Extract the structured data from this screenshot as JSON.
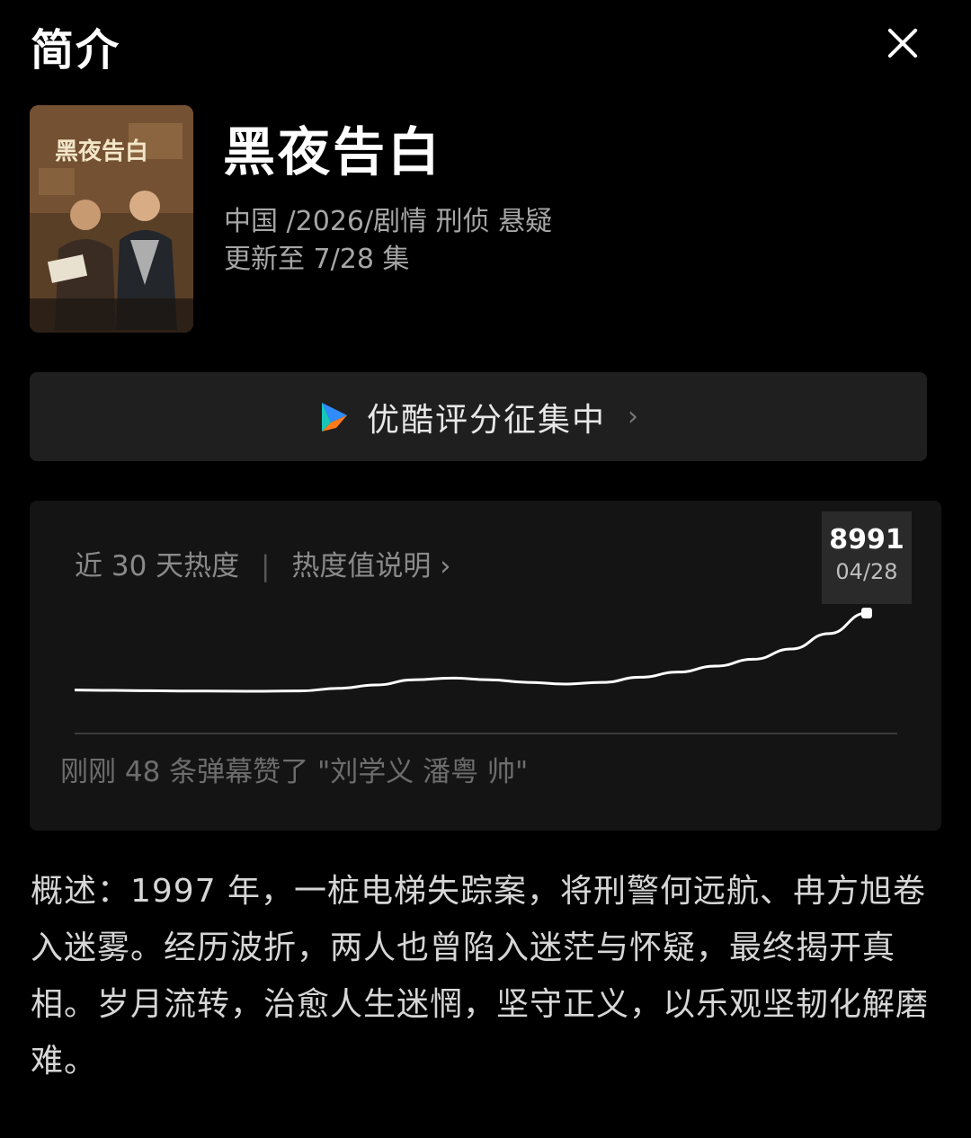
{
  "header": {
    "title": "简介"
  },
  "show": {
    "poster_title": "黑夜告白",
    "title": "黑夜告白",
    "meta_line1": "中国 /2026/剧情 刑侦 悬疑",
    "meta_line2": "更新至 7/28 集"
  },
  "rating": {
    "label": "优酷评分征集中",
    "chevron": "›"
  },
  "heat": {
    "label": "近 30 天热度",
    "separator": "|",
    "link_label": "热度值说明 ›",
    "tooltip_value": "8991",
    "tooltip_date": "04/28",
    "danmu_text": "刚刚 48 条弹幕赞了 \"刘学义 潘粤 帅\""
  },
  "synopsis": "概述：1997 年，一桩电梯失踪案，将刑警何远航、冉方旭卷入迷雾。经历波折，两人也曾陷入迷茫与怀疑，最终揭开真相。岁月流转，治愈人生迷惘，坚守正义，以乐观坚韧化解磨难。",
  "chart_data": {
    "type": "line",
    "series": [
      {
        "values": [
          10,
          9.6,
          9.2,
          8.9,
          8.7,
          8.6,
          9,
          12,
          16,
          22,
          24,
          22,
          19,
          17,
          19,
          25,
          31,
          38,
          46,
          58,
          76,
          100
        ]
      }
    ],
    "highlight": {
      "date": "04/28",
      "value": 8991
    },
    "colors": {
      "line": "#ffffff",
      "baseline": "#3a3a3a"
    }
  },
  "colors": {
    "background": "#000000",
    "card": "#1f1f1f",
    "heat_card": "#141414",
    "youku_blue": "#2f8cff",
    "youku_orange": "#ff7a1a"
  }
}
